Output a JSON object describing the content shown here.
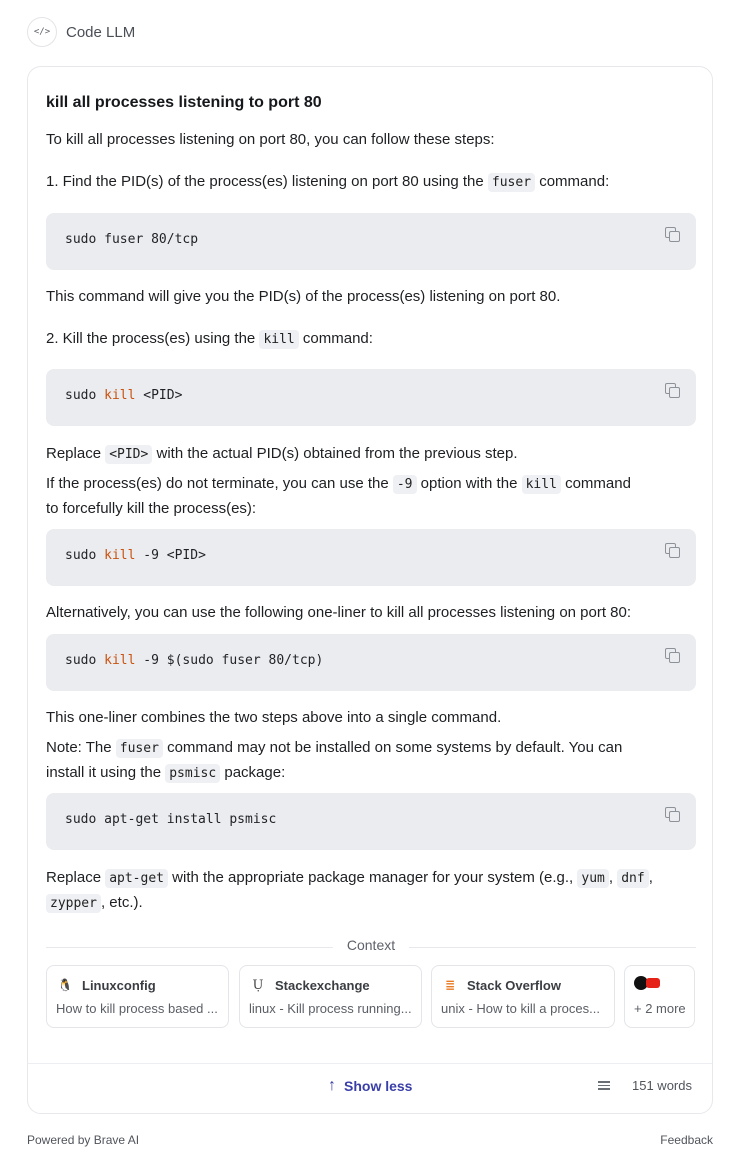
{
  "header": {
    "icon": "code-icon",
    "icon_glyph": "</>",
    "title": "Code LLM"
  },
  "answer": {
    "question": "kill all processes listening to port 80",
    "intro": "To kill all processes listening on port 80, you can follow these steps:",
    "step1_pre": "1. Find the PID(s) of the process(es) listening on port 80 using the ",
    "step1_code": "fuser",
    "step1_post": " command:",
    "code1": {
      "pre": "sudo fuser 80/tcp",
      "kw": "",
      "post": ""
    },
    "after_code1": "This command will give you the PID(s) of the process(es) listening on port 80.",
    "step2_pre": "2. Kill the process(es) using the ",
    "step2_code": "kill",
    "step2_post": " command:",
    "code2": {
      "pre": "sudo ",
      "kw": "kill",
      "post": " <PID>"
    },
    "replace_pre": "Replace ",
    "replace_code": "<PID>",
    "replace_post": " with the actual PID(s) obtained from the previous step.",
    "force_a": "If the process(es) do not terminate, you can use the ",
    "force_code1": "-9",
    "force_b": " option with the ",
    "force_code2": "kill",
    "force_c": " command",
    "force_line2": "to forcefully kill the process(es):",
    "code3": {
      "pre": "sudo ",
      "kw": "kill",
      "post": " -9 <PID>"
    },
    "alt": "Alternatively, you can use the following one-liner to kill all processes listening on port 80:",
    "code4": {
      "pre": "sudo ",
      "kw": "kill",
      "post": " -9 $(sudo fuser 80/tcp)"
    },
    "combine": "This one-liner combines the two steps above into a single command.",
    "note_a": "Note: The ",
    "note_code": "fuser",
    "note_b": " command may not be installed on some systems by default. You can",
    "note_line2_a": "install it using the ",
    "note_line2_code": "psmisc",
    "note_line2_b": " package:",
    "code5": {
      "pre": "sudo apt-get install psmisc",
      "kw": "",
      "post": ""
    },
    "final_a": "Replace ",
    "final_code1": "apt-get",
    "final_b": " with the appropriate package manager for your system (e.g., ",
    "final_code2": "yum",
    "final_c": ", ",
    "final_code3": "dnf",
    "final_d": ",",
    "final_code4": "zypper",
    "final_e": ", etc.)."
  },
  "context": {
    "label": "Context",
    "sources": [
      {
        "name": "Linuxconfig",
        "desc": "How to kill process based ...",
        "icon": "tux-penguin-icon",
        "glyph": "🐧"
      },
      {
        "name": "Stackexchange",
        "desc": "linux - Kill process running...",
        "icon": "unix-linux-stackexchange-icon",
        "glyph": "Ụ"
      },
      {
        "name": "Stack Overflow",
        "desc": "unix - How to kill a proces...",
        "icon": "stack-overflow-icon",
        "glyph": "≣"
      }
    ],
    "more": {
      "label": "+ 2 more",
      "icons": [
        "github-icon",
        "youtube-icon"
      ]
    }
  },
  "footer": {
    "show_less": "Show less",
    "word_count": "151 words",
    "powered_by": "Powered by Brave AI",
    "feedback": "Feedback"
  },
  "colors": {
    "accent": "#3a3fa8",
    "keyword": "#c9520f",
    "code_bg": "#ebecef"
  }
}
